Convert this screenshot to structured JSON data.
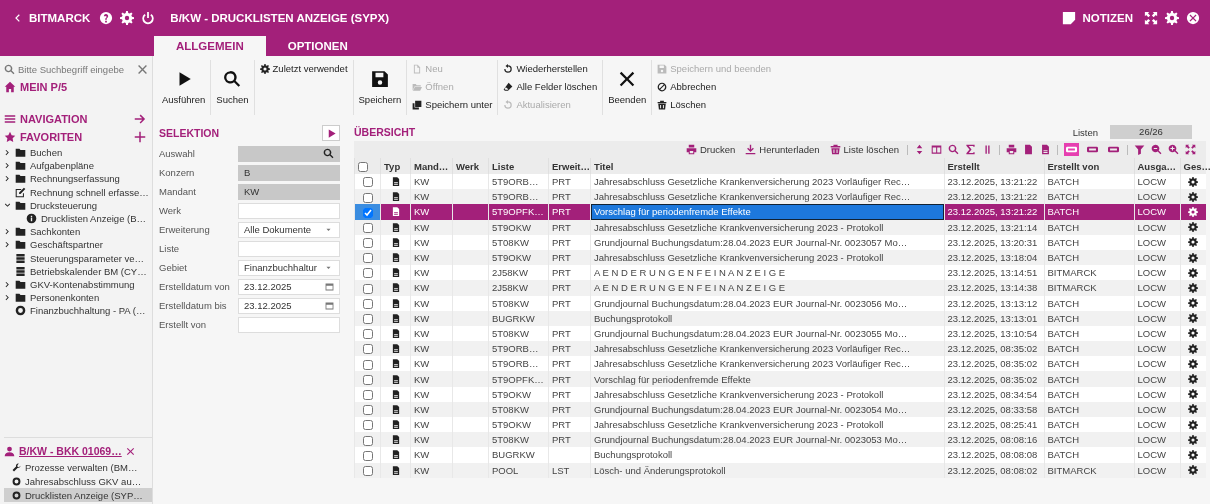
{
  "app_bar": {
    "brand": "BITMARCK",
    "title": "B/KW - DRUCKLISTEN ANZEIGE (SYPX)",
    "notes": "NOTIZEN"
  },
  "tabs": [
    {
      "label": "ALLGEMEIN",
      "selected": true
    },
    {
      "label": "OPTIONEN",
      "selected": false
    }
  ],
  "toolbar": [
    {
      "kind": "run",
      "label": "Ausführen"
    },
    {
      "kind": "search",
      "label": "Suchen"
    },
    {
      "items": [
        {
          "kind": "recent",
          "label": "Zuletzt verwendet",
          "disabled": false
        }
      ]
    },
    {
      "kind": "save",
      "label": "Speichern"
    },
    {
      "items": [
        {
          "kind": "new",
          "label": "Neu",
          "disabled": true
        },
        {
          "kind": "open",
          "label": "Öffnen",
          "disabled": true
        },
        {
          "kind": "save-as",
          "label": "Speichern unter",
          "disabled": false
        }
      ]
    },
    {
      "items": [
        {
          "kind": "restore",
          "label": "Wiederherstellen",
          "disabled": false
        },
        {
          "kind": "clear",
          "label": "Alle Felder löschen",
          "disabled": false
        },
        {
          "kind": "refresh",
          "label": "Aktualisieren",
          "disabled": true
        }
      ]
    },
    {
      "kind": "close",
      "label": "Beenden"
    },
    {
      "items": [
        {
          "kind": "save-close",
          "label": "Speichern und beenden",
          "disabled": true
        },
        {
          "kind": "cancel",
          "label": "Abbrechen",
          "disabled": false
        },
        {
          "kind": "delete",
          "label": "Löschen",
          "disabled": false
        }
      ]
    }
  ],
  "sidebar": {
    "search": {
      "placeholder": "Bitte Suchbegriff eingebe"
    },
    "home": "MEIN P/5",
    "navigation": "NAVIGATION",
    "favorites": "FAVORITEN",
    "tree": [
      {
        "kind": "folder",
        "label": "Buchen",
        "expanded": false
      },
      {
        "kind": "folder",
        "label": "Aufgabenpläne",
        "expanded": false
      },
      {
        "kind": "folder",
        "label": "Rechnungserfassung",
        "expanded": false
      },
      {
        "kind": "edit",
        "label": "Rechnung schnell erfasse…"
      },
      {
        "kind": "folder",
        "label": "Drucksteuerung",
        "expanded": true,
        "children": [
          {
            "kind": "info",
            "label": "Drucklisten Anzeige (B…"
          }
        ]
      },
      {
        "kind": "folder",
        "label": "Sachkonten",
        "expanded": false
      },
      {
        "kind": "folder",
        "label": "Geschäftspartner",
        "expanded": false
      },
      {
        "kind": "database",
        "label": "Steuerungsparameter ve…"
      },
      {
        "kind": "database",
        "label": "Betriebskalender BM (CY…"
      },
      {
        "kind": "folder",
        "label": "GKV-Kontenabstimmung",
        "expanded": false
      },
      {
        "kind": "folder",
        "label": "Personenkonten",
        "expanded": false
      },
      {
        "kind": "process",
        "label": "Finanzbuchhaltung - PA (…"
      }
    ],
    "session": {
      "label": "B/KW - BKK 01069…",
      "items": [
        {
          "kind": "tool",
          "label": "Prozesse verwalten (BM…",
          "selected": false
        },
        {
          "kind": "process",
          "label": "Jahresabschluss GKV au…",
          "selected": false
        },
        {
          "kind": "process",
          "label": "Drucklisten Anzeige (SYP…",
          "selected": true
        }
      ]
    }
  },
  "selection": {
    "title": "SELEKTION",
    "fields": [
      {
        "label": "Auswahl",
        "kind": "lookup"
      },
      {
        "label": "Konzern",
        "kind": "readonly",
        "value": "B"
      },
      {
        "label": "Mandant",
        "kind": "readonly",
        "value": "KW"
      },
      {
        "label": "Werk",
        "kind": "text"
      },
      {
        "label": "Erweiterung",
        "kind": "select",
        "value": "Alle Dokumente"
      },
      {
        "label": "Liste",
        "kind": "text"
      },
      {
        "label": "Gebiet",
        "kind": "select",
        "value": "Finanzbuchhaltur"
      },
      {
        "label": "Erstelldatum von",
        "kind": "date",
        "value": "23.12.2025"
      },
      {
        "label": "Erstelldatum bis",
        "kind": "date",
        "value": "23.12.2025"
      },
      {
        "label": "Erstellt von",
        "kind": "text"
      }
    ]
  },
  "overview": {
    "title": "ÜBERSICHT",
    "count_label": "Listen",
    "count": "26/26",
    "actions": [
      {
        "kind": "print",
        "label": "Drucken"
      },
      {
        "kind": "download",
        "label": "Herunterladen"
      },
      {
        "kind": "delete",
        "label": "Liste löschen"
      }
    ],
    "row_views": [
      {
        "selected": true
      },
      {
        "selected": false
      },
      {
        "selected": false
      }
    ],
    "header_checked": false,
    "columns": [
      "Typ",
      "Mand…",
      "Werk",
      "Liste",
      "Erweit…",
      "Titel",
      "Erstellt",
      "Erstellt von",
      "Ausga…",
      "Ges…"
    ],
    "rows": [
      {
        "selected": false,
        "checked": false,
        "mandant": "KW",
        "liste": "5T9ORB…",
        "erweiterung": "PRT",
        "titel": "Jahresabschluss Gesetzliche Krankenversicherung 2023 Vorläufiger Rec…",
        "erstellt": "23.12.2025, 13:21:22",
        "erstellt_von": "BATCH",
        "ausgabe": "LOCW"
      },
      {
        "selected": false,
        "checked": false,
        "mandant": "KW",
        "liste": "5T9ORB…",
        "erweiterung": "PRT",
        "titel": "Jahresabschluss Gesetzliche Krankenversicherung 2023 Vorläufiger Rec…",
        "erstellt": "23.12.2025, 13:21:22",
        "erstellt_von": "BATCH",
        "ausgabe": "LOCW"
      },
      {
        "selected": true,
        "checked": true,
        "mandant": "KW",
        "liste": "5T9OPFK…",
        "erweiterung": "PRT",
        "titel": "Vorschlag für periodenfremde Effekte",
        "erstellt": "23.12.2025, 13:21:22",
        "erstellt_von": "BATCH",
        "ausgabe": "LOCW"
      },
      {
        "selected": false,
        "checked": false,
        "mandant": "KW",
        "liste": "5T9OKW",
        "erweiterung": "PRT",
        "titel": "Jahresabschluss Gesetzliche Krankvenversicherung 2023 - Protokoll",
        "erstellt": "23.12.2025, 13:21:14",
        "erstellt_von": "BATCH",
        "ausgabe": "LOCW"
      },
      {
        "selected": false,
        "checked": false,
        "mandant": "KW",
        "liste": "5T08KW",
        "erweiterung": "PRT",
        "titel": "Grundjournal Buchungsdatum:28.04.2023 EUR Journal-Nr. 0023057 Mo…",
        "erstellt": "23.12.2025, 13:20:31",
        "erstellt_von": "BATCH",
        "ausgabe": "LOCW"
      },
      {
        "selected": false,
        "checked": false,
        "mandant": "KW",
        "liste": "5T9OKW",
        "erweiterung": "PRT",
        "titel": "Jahresabschluss Gesetzliche Krankvenversicherung 2023 - Protokoll",
        "erstellt": "23.12.2025, 13:18:04",
        "erstellt_von": "BATCH",
        "ausgabe": "LOCW"
      },
      {
        "selected": false,
        "checked": false,
        "mandant": "KW",
        "liste": "2J58KW",
        "erweiterung": "PRT",
        "titel": "A E N D E R U N G E N F E I N A N Z E I G E",
        "erstellt": "23.12.2025, 13:14:51",
        "erstellt_von": "BITMARCK",
        "ausgabe": "LOCW"
      },
      {
        "selected": false,
        "checked": false,
        "mandant": "KW",
        "liste": "2J58KW",
        "erweiterung": "PRT",
        "titel": "A E N D E R U N G E N F E I N A N Z E I G E",
        "erstellt": "23.12.2025, 13:14:38",
        "erstellt_von": "BITMARCK",
        "ausgabe": "LOCW"
      },
      {
        "selected": false,
        "checked": false,
        "mandant": "KW",
        "liste": "5T08KW",
        "erweiterung": "PRT",
        "titel": "Grundjournal Buchungsdatum:28.04.2023 EUR Journal-Nr. 0023056 Mo…",
        "erstellt": "23.12.2025, 13:13:12",
        "erstellt_von": "BATCH",
        "ausgabe": "LOCW"
      },
      {
        "selected": false,
        "checked": false,
        "mandant": "KW",
        "liste": "BUGRKW",
        "titel": "Buchungsprotokoll",
        "erstellt": "23.12.2025, 13:13:01",
        "erstellt_von": "BATCH",
        "ausgabe": "LOCW"
      },
      {
        "selected": false,
        "checked": false,
        "mandant": "KW",
        "liste": "5T08KW",
        "erweiterung": "PRT",
        "titel": "Grundjournal Buchungsdatum:28.04.2023 EUR Journal-Nr. 0023055 Mo…",
        "erstellt": "23.12.2025, 13:10:54",
        "erstellt_von": "BATCH",
        "ausgabe": "LOCW"
      },
      {
        "selected": false,
        "checked": false,
        "mandant": "KW",
        "liste": "5T9ORB…",
        "erweiterung": "PRT",
        "titel": "Jahresabschluss Gesetzliche Krankenversicherung 2023 Vorläufiger Rec…",
        "erstellt": "23.12.2025, 08:35:02",
        "erstellt_von": "BATCH",
        "ausgabe": "LOCW"
      },
      {
        "selected": false,
        "checked": false,
        "mandant": "KW",
        "liste": "5T9ORB…",
        "erweiterung": "PRT",
        "titel": "Jahresabschluss Gesetzliche Krankenversicherung 2023 Vorläufiger Rec…",
        "erstellt": "23.12.2025, 08:35:02",
        "erstellt_von": "BATCH",
        "ausgabe": "LOCW"
      },
      {
        "selected": false,
        "checked": false,
        "mandant": "KW",
        "liste": "5T9OPFK…",
        "erweiterung": "PRT",
        "titel": "Vorschlag für periodenfremde Effekte",
        "erstellt": "23.12.2025, 08:35:02",
        "erstellt_von": "BATCH",
        "ausgabe": "LOCW"
      },
      {
        "selected": false,
        "checked": false,
        "mandant": "KW",
        "liste": "5T9OKW",
        "erweiterung": "PRT",
        "titel": "Jahresabschluss Gesetzliche Krankvenversicherung 2023 - Protokoll",
        "erstellt": "23.12.2025, 08:34:54",
        "erstellt_von": "BATCH",
        "ausgabe": "LOCW"
      },
      {
        "selected": false,
        "checked": false,
        "mandant": "KW",
        "liste": "5T08KW",
        "erweiterung": "PRT",
        "titel": "Grundjournal Buchungsdatum:28.04.2023 EUR Journal-Nr. 0023054 Mo…",
        "erstellt": "23.12.2025, 08:33:58",
        "erstellt_von": "BATCH",
        "ausgabe": "LOCW"
      },
      {
        "selected": false,
        "checked": false,
        "mandant": "KW",
        "liste": "5T9OKW",
        "erweiterung": "PRT",
        "titel": "Jahresabschluss Gesetzliche Krankvenversicherung 2023 - Protokoll",
        "erstellt": "23.12.2025, 08:25:41",
        "erstellt_von": "BATCH",
        "ausgabe": "LOCW"
      },
      {
        "selected": false,
        "checked": false,
        "mandant": "KW",
        "liste": "5T08KW",
        "erweiterung": "PRT",
        "titel": "Grundjournal Buchungsdatum:28.04.2023 EUR Journal-Nr. 0023053 Mo…",
        "erstellt": "23.12.2025, 08:08:16",
        "erstellt_von": "BATCH",
        "ausgabe": "LOCW"
      },
      {
        "selected": false,
        "checked": false,
        "mandant": "KW",
        "liste": "BUGRKW",
        "titel": "Buchungsprotokoll",
        "erstellt": "23.12.2025, 08:08:08",
        "erstellt_von": "BATCH",
        "ausgabe": "LOCW"
      },
      {
        "selected": false,
        "checked": false,
        "mandant": "KW",
        "liste": "POOL",
        "erweiterung": "LST",
        "titel": "Lösch- und Änderungsprotokoll",
        "erstellt": "23.12.2025, 08:08:02",
        "erstellt_von": "BITMARCK",
        "ausgabe": "LOCW"
      }
    ]
  }
}
